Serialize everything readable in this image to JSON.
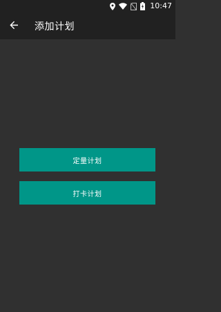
{
  "status_bar": {
    "time": "10:47",
    "icons": [
      "location-icon",
      "wifi-icon",
      "no-sim-icon",
      "battery-icon"
    ]
  },
  "app_bar": {
    "back_icon": "arrow-back-icon",
    "title": "添加计划"
  },
  "buttons": {
    "quantitative_plan": "定量计划",
    "checkin_plan": "打卡计划"
  },
  "colors": {
    "background": "#303030",
    "app_bar": "#212121",
    "accent": "#009688",
    "text": "#ffffff"
  }
}
